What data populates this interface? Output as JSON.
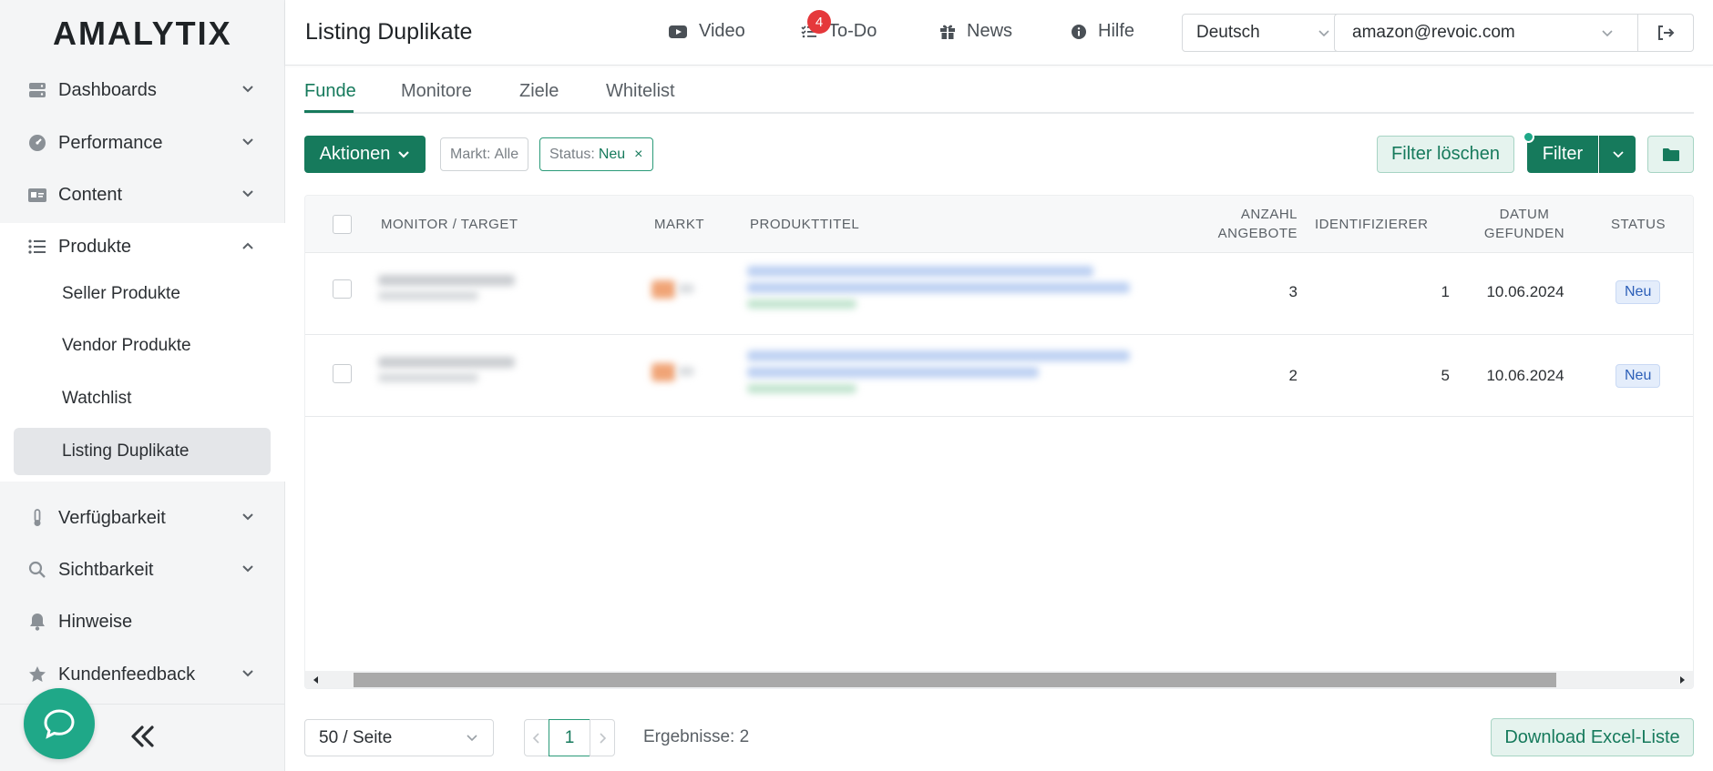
{
  "brand": "AMALYTIX",
  "sidebar": {
    "items": [
      {
        "label": "Dashboards",
        "icon": "server-icon"
      },
      {
        "label": "Performance",
        "icon": "gauge-icon"
      },
      {
        "label": "Content",
        "icon": "id-card-icon"
      },
      {
        "label": "Produkte",
        "icon": "list-icon"
      },
      {
        "label": "Verfügbarkeit",
        "icon": "thermometer-icon"
      },
      {
        "label": "Sichtbarkeit",
        "icon": "search-icon"
      },
      {
        "label": "Hinweise",
        "icon": "bell-icon"
      },
      {
        "label": "Kundenfeedback",
        "icon": "star-icon"
      }
    ],
    "subitems": [
      {
        "label": "Seller Produkte"
      },
      {
        "label": "Vendor Produkte"
      },
      {
        "label": "Watchlist"
      },
      {
        "label": "Listing Duplikate"
      }
    ]
  },
  "header": {
    "title": "Listing Duplikate",
    "links": {
      "video": "Video",
      "todo": "To-Do",
      "todo_count": "4",
      "news": "News",
      "hilfe": "Hilfe"
    },
    "language": "Deutsch",
    "account": "amazon@revoic.com"
  },
  "tabs": [
    "Funde",
    "Monitore",
    "Ziele",
    "Whitelist"
  ],
  "toolbar": {
    "actions": "Aktionen",
    "chip_markt_label": "Markt:",
    "chip_markt_value": "Alle",
    "chip_status_label": "Status:",
    "chip_status_value": "Neu",
    "clear_filter": "Filter löschen",
    "filter": "Filter"
  },
  "table": {
    "headers": {
      "monitor": "MONITOR / TARGET",
      "markt": "MARKT",
      "produkttitel": "PRODUKTTITEL",
      "anzahl_1": "ANZAHL",
      "anzahl_2": "ANGEBOTE",
      "identifizierer": "IDENTIFIZIERER",
      "datum_1": "DATUM",
      "datum_2": "GEFUNDEN",
      "status": "STATUS"
    },
    "rows": [
      {
        "anzahl": "3",
        "identifizierer": "1",
        "datum": "10.06.2024",
        "status": "Neu"
      },
      {
        "anzahl": "2",
        "identifizierer": "5",
        "datum": "10.06.2024",
        "status": "Neu"
      }
    ]
  },
  "footer": {
    "page_size": "50 / Seite",
    "current_page": "1",
    "results": "Ergebnisse: 2",
    "download": "Download Excel-Liste"
  },
  "colors": {
    "accent": "#167a5c",
    "badge": "#e5383b",
    "chat": "#1fa888"
  }
}
